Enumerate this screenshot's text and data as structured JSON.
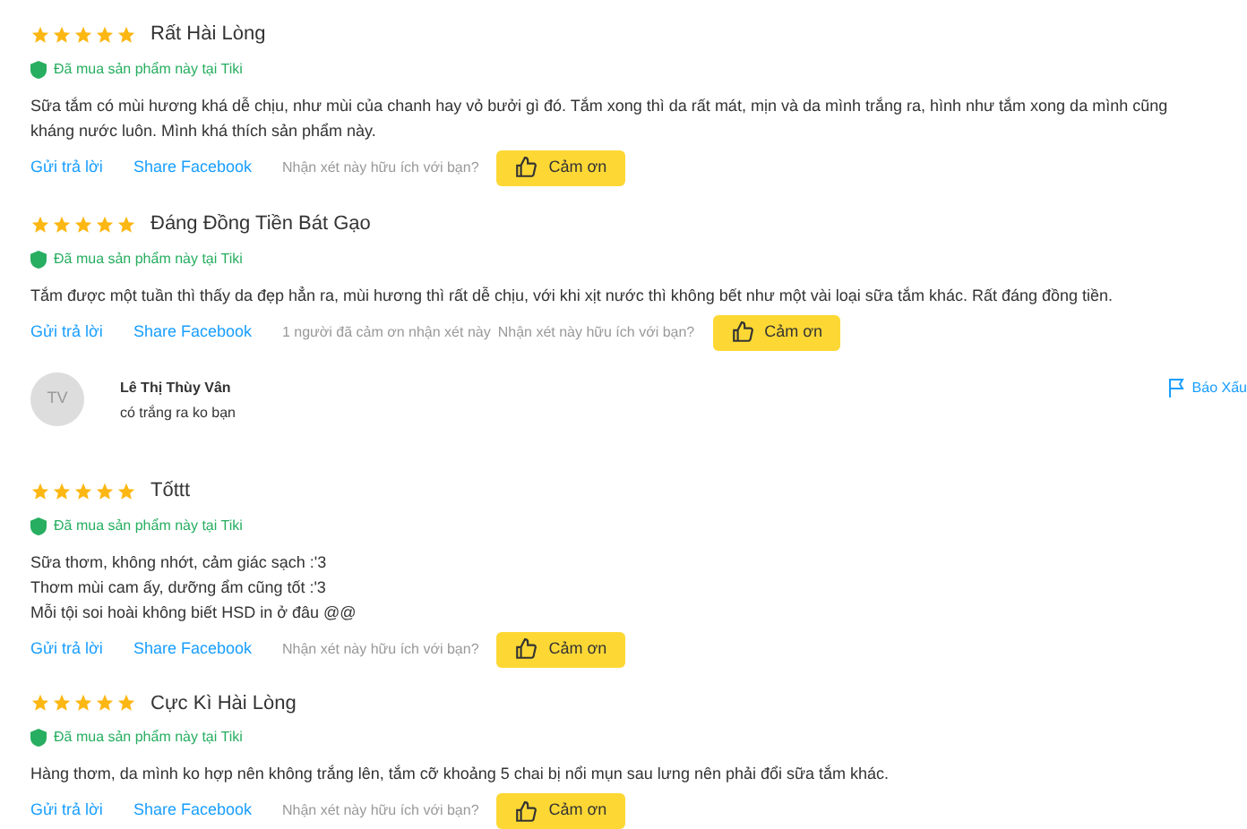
{
  "reviews": [
    {
      "stars": 5,
      "title": "Rất Hài Lòng",
      "verified": "Đã mua sản phẩm này tại Tiki",
      "body": [
        "Sữa tắm có mùi hương khá dễ chịu, như mùi của chanh hay vỏ bưởi gì đó. Tắm xong thì da rất mát, mịn và da mình trắng ra, hình như tắm xong da mình cũng kháng nước luôn. Mình khá thích sản phẩm này."
      ],
      "reply": "Gửi trả lời",
      "share": "Share Facebook",
      "question": "Nhận xét này hữu ích với bạn?",
      "thanks": "Cảm ơn"
    },
    {
      "stars": 5,
      "title": "Đáng Đồng Tiền Bát Gạo",
      "verified": "Đã mua sản phẩm này tại Tiki",
      "body": [
        "Tắm được một tuần thì thấy da đẹp hẳn ra, mùi hương thì rất dễ chịu, với khi xịt nước thì không bết như một vài loại sữa tắm khác. Rất đáng đồng tiền."
      ],
      "reply": "Gửi trả lời",
      "share": "Share Facebook",
      "thanked_count": "1 người đã cảm ơn nhận xét này",
      "question": "Nhận xét này hữu ích với bạn?",
      "thanks": "Cảm ơn",
      "comments": [
        {
          "initials": "TV",
          "name": "Lê Thị Thùy Vân",
          "text": "có trắng ra ko bạn",
          "report": "Báo Xấu"
        }
      ]
    },
    {
      "stars": 5,
      "title": "Tốttt",
      "verified": "Đã mua sản phẩm này tại Tiki",
      "body": [
        "Sữa thơm, không nhớt, cảm giác sạch :'3",
        "Thơm mùi cam ấy, dưỡng ẩm cũng tốt :'3",
        "Mỗi tội soi hoài không biết HSD in ở đâu @@"
      ],
      "reply": "Gửi trả lời",
      "share": "Share Facebook",
      "question": "Nhận xét này hữu ích với bạn?",
      "thanks": "Cảm ơn"
    },
    {
      "stars": 5,
      "title": "Cực Kì Hài Lòng",
      "verified": "Đã mua sản phẩm này tại Tiki",
      "body": [
        "Hàng thơm, da mình ko hợp nên không trắng lên, tắm cỡ khoảng 5 chai bị nổi mụn sau lưng nên phải đổi sữa tắm khác."
      ],
      "reply": "Gửi trả lời",
      "share": "Share Facebook",
      "question": "Nhận xét này hữu ích với bạn?",
      "thanks": "Cảm ơn"
    }
  ]
}
